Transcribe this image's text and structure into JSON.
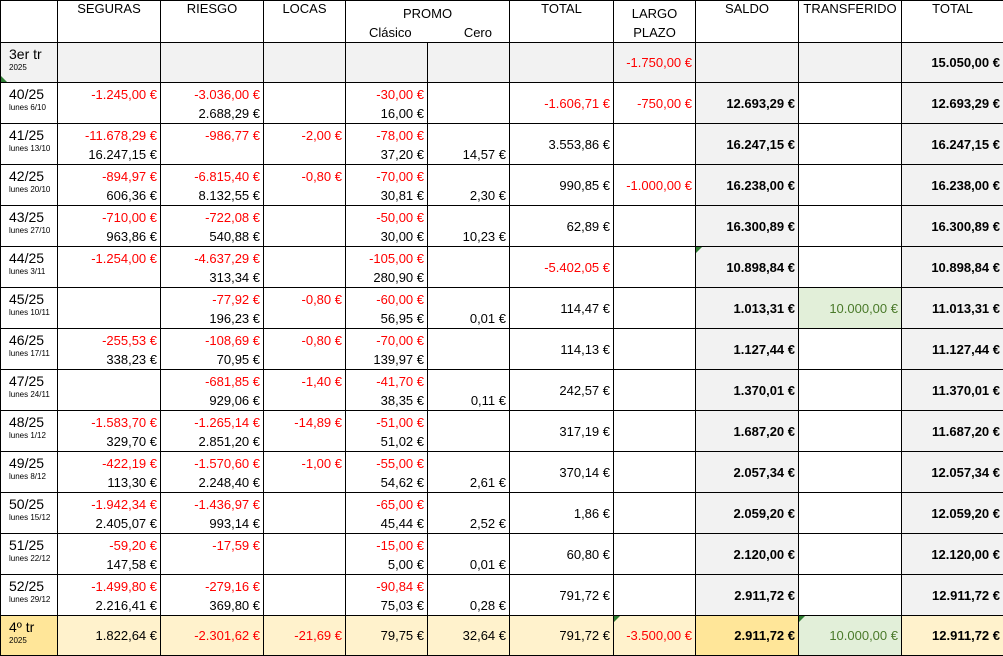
{
  "headers": {
    "seguras": "SEGURAS",
    "riesgo": "RIESGO",
    "locas": "LOCAS",
    "promo": "PROMO",
    "clasico": "Clásico",
    "cero": "Cero",
    "total": "TOTAL",
    "largo": "LARGO",
    "plazo": "PLAZO",
    "saldo": "SALDO",
    "transferido": "TRANSFERIDO",
    "total2": "TOTAL"
  },
  "q3": {
    "week": "3er tr",
    "year": "2025",
    "largo": "-1.750,00 €",
    "total": "15.050,00 €"
  },
  "rows": [
    {
      "wn": "40/25",
      "wd": "lunes 6/10",
      "seg": [
        "-1.245,00 €",
        ""
      ],
      "rie": [
        "-3.036,00 €",
        "2.688,29 €"
      ],
      "loc": [
        "",
        ""
      ],
      "cla": [
        "-30,00 €",
        "16,00 €"
      ],
      "cero": "",
      "total": "-1.606,71 €",
      "largo": "-750,00 €",
      "saldo": "12.693,29 €",
      "trans": "",
      "total2": "12.693,29 €"
    },
    {
      "wn": "41/25",
      "wd": "lunes 13/10",
      "seg": [
        "-11.678,29 €",
        "16.247,15 €"
      ],
      "rie": [
        "-986,77 €",
        ""
      ],
      "loc": [
        "-2,00 €",
        ""
      ],
      "cla": [
        "-78,00 €",
        "37,20 €"
      ],
      "cero": "14,57 €",
      "total": "3.553,86 €",
      "largo": "",
      "saldo": "16.247,15 €",
      "trans": "",
      "total2": "16.247,15 €"
    },
    {
      "wn": "42/25",
      "wd": "lunes 20/10",
      "seg": [
        "-894,97 €",
        "606,36 €"
      ],
      "rie": [
        "-6.815,40 €",
        "8.132,55 €"
      ],
      "loc": [
        "-0,80 €",
        ""
      ],
      "cla": [
        "-70,00 €",
        "30,81 €"
      ],
      "cero": "2,30 €",
      "total": "990,85 €",
      "largo": "-1.000,00 €",
      "saldo": "16.238,00 €",
      "trans": "",
      "total2": "16.238,00 €"
    },
    {
      "wn": "43/25",
      "wd": "lunes 27/10",
      "seg": [
        "-710,00 €",
        "963,86 €"
      ],
      "rie": [
        "-722,08 €",
        "540,88 €"
      ],
      "loc": [
        "",
        ""
      ],
      "cla": [
        "-50,00 €",
        "30,00 €"
      ],
      "cero": "10,23 €",
      "total": "62,89 €",
      "largo": "",
      "saldo": "16.300,89 €",
      "trans": "",
      "total2": "16.300,89 €"
    },
    {
      "wn": "44/25",
      "wd": "lunes 3/11",
      "seg": [
        "-1.254,00 €",
        ""
      ],
      "rie": [
        "-4.637,29 €",
        "313,34 €"
      ],
      "loc": [
        "",
        ""
      ],
      "cla": [
        "-105,00 €",
        "280,90 €"
      ],
      "cero": "",
      "total": "-5.402,05 €",
      "largo": "",
      "saldo": "10.898,84 €",
      "trans": "",
      "total2": "10.898,84 €"
    },
    {
      "wn": "45/25",
      "wd": "lunes 10/11",
      "seg": [
        "",
        ""
      ],
      "rie": [
        "-77,92 €",
        "196,23 €"
      ],
      "loc": [
        "-0,80 €",
        ""
      ],
      "cla": [
        "-60,00 €",
        "56,95 €"
      ],
      "cero": "0,01 €",
      "total": "114,47 €",
      "largo": "",
      "saldo": "1.013,31 €",
      "trans": "10.000,00 €",
      "total2": "11.013,31 €"
    },
    {
      "wn": "46/25",
      "wd": "lunes 17/11",
      "seg": [
        "-255,53 €",
        "338,23 €"
      ],
      "rie": [
        "-108,69 €",
        "70,95 €"
      ],
      "loc": [
        "-0,80 €",
        ""
      ],
      "cla": [
        "-70,00 €",
        "139,97 €"
      ],
      "cero": "",
      "total": "114,13 €",
      "largo": "",
      "saldo": "1.127,44 €",
      "trans": "",
      "total2": "11.127,44 €"
    },
    {
      "wn": "47/25",
      "wd": "lunes 24/11",
      "seg": [
        "",
        ""
      ],
      "rie": [
        "-681,85 €",
        "929,06 €"
      ],
      "loc": [
        "-1,40 €",
        ""
      ],
      "cla": [
        "-41,70 €",
        "38,35 €"
      ],
      "cero": "0,11 €",
      "total": "242,57 €",
      "largo": "",
      "saldo": "1.370,01 €",
      "trans": "",
      "total2": "11.370,01 €"
    },
    {
      "wn": "48/25",
      "wd": "lunes 1/12",
      "seg": [
        "-1.583,70 €",
        "329,70 €"
      ],
      "rie": [
        "-1.265,14 €",
        "2.851,20 €"
      ],
      "loc": [
        "-14,89 €",
        ""
      ],
      "cla": [
        "-51,00 €",
        "51,02 €"
      ],
      "cero": "",
      "total": "317,19 €",
      "largo": "",
      "saldo": "1.687,20 €",
      "trans": "",
      "total2": "11.687,20 €"
    },
    {
      "wn": "49/25",
      "wd": "lunes 8/12",
      "seg": [
        "-422,19 €",
        "113,30 €"
      ],
      "rie": [
        "-1.570,60 €",
        "2.248,40 €"
      ],
      "loc": [
        "-1,00 €",
        ""
      ],
      "cla": [
        "-55,00 €",
        "54,62 €"
      ],
      "cero": "2,61 €",
      "total": "370,14 €",
      "largo": "",
      "saldo": "2.057,34 €",
      "trans": "",
      "total2": "12.057,34 €"
    },
    {
      "wn": "50/25",
      "wd": "lunes 15/12",
      "seg": [
        "-1.942,34 €",
        "2.405,07 €"
      ],
      "rie": [
        "-1.436,97 €",
        "993,14 €"
      ],
      "loc": [
        "",
        ""
      ],
      "cla": [
        "-65,00 €",
        "45,44 €"
      ],
      "cero": "2,52 €",
      "total": "1,86 €",
      "largo": "",
      "saldo": "2.059,20 €",
      "trans": "",
      "total2": "12.059,20 €"
    },
    {
      "wn": "51/25",
      "wd": "lunes 22/12",
      "seg": [
        "-59,20 €",
        "147,58 €"
      ],
      "rie": [
        "-17,59 €",
        ""
      ],
      "loc": [
        "",
        ""
      ],
      "cla": [
        "-15,00 €",
        "5,00 €"
      ],
      "cero": "0,01 €",
      "total": "60,80 €",
      "largo": "",
      "saldo": "2.120,00 €",
      "trans": "",
      "total2": "12.120,00 €"
    },
    {
      "wn": "52/25",
      "wd": "lunes 29/12",
      "seg": [
        "-1.499,80 €",
        "2.216,41 €"
      ],
      "rie": [
        "-279,16 €",
        "369,80 €"
      ],
      "loc": [
        "",
        ""
      ],
      "cla": [
        "-90,84 €",
        "75,03 €"
      ],
      "cero": "0,28 €",
      "total": "791,72 €",
      "largo": "",
      "saldo": "2.911,72 €",
      "trans": "",
      "total2": "12.911,72 €"
    }
  ],
  "q4": {
    "week": "4º tr",
    "year": "2025",
    "seg": "1.822,64 €",
    "rie": "-2.301,62 €",
    "loc": "-21,69 €",
    "cla": "79,75 €",
    "cero": "32,64 €",
    "total": "791,72 €",
    "largo": "-3.500,00 €",
    "saldo": "2.911,72 €",
    "trans": "10.000,00 €",
    "total2": "12.911,72 €"
  },
  "colors": {
    "negative": "#ff0000",
    "saldo_bg": "#f2f2f2",
    "transfer_bg": "#e2efd9",
    "quarter_bg": "#fff2cc"
  }
}
